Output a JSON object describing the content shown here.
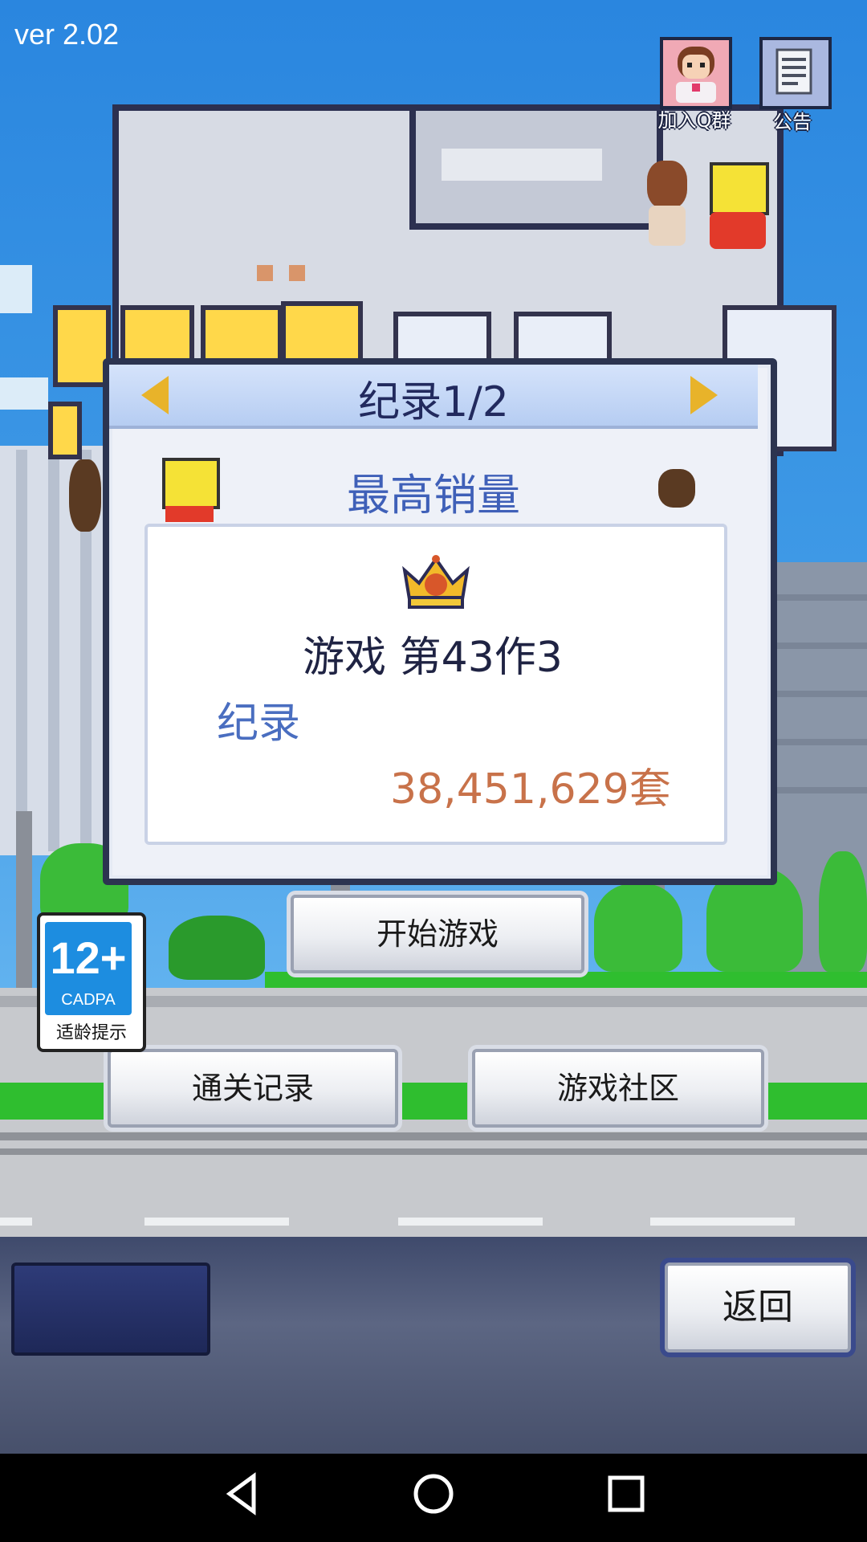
{
  "version": "ver 2.02",
  "top_icons": {
    "qq_group_label": "加入Q群",
    "notice_label": "公告"
  },
  "dialog": {
    "title": "纪录1/2",
    "heading": "最高销量",
    "game_name": "游戏 第43作3",
    "record_label": "纪录",
    "sales_value": "38,451,629套"
  },
  "buttons": {
    "start": "开始游戏",
    "clear_records": "通关记录",
    "community": "游戏社区",
    "back": "返回"
  },
  "age_rating": {
    "number": "12+",
    "org": "CADPA",
    "label": "适龄提示"
  },
  "icons": [
    "left-arrow-icon",
    "right-arrow-icon",
    "crown-icon",
    "qq-group-icon",
    "notice-icon"
  ],
  "colors": {
    "accent_arrow": "#e8b32a",
    "record_heading": "#3f60b8",
    "sales_value": "#c8724a"
  }
}
